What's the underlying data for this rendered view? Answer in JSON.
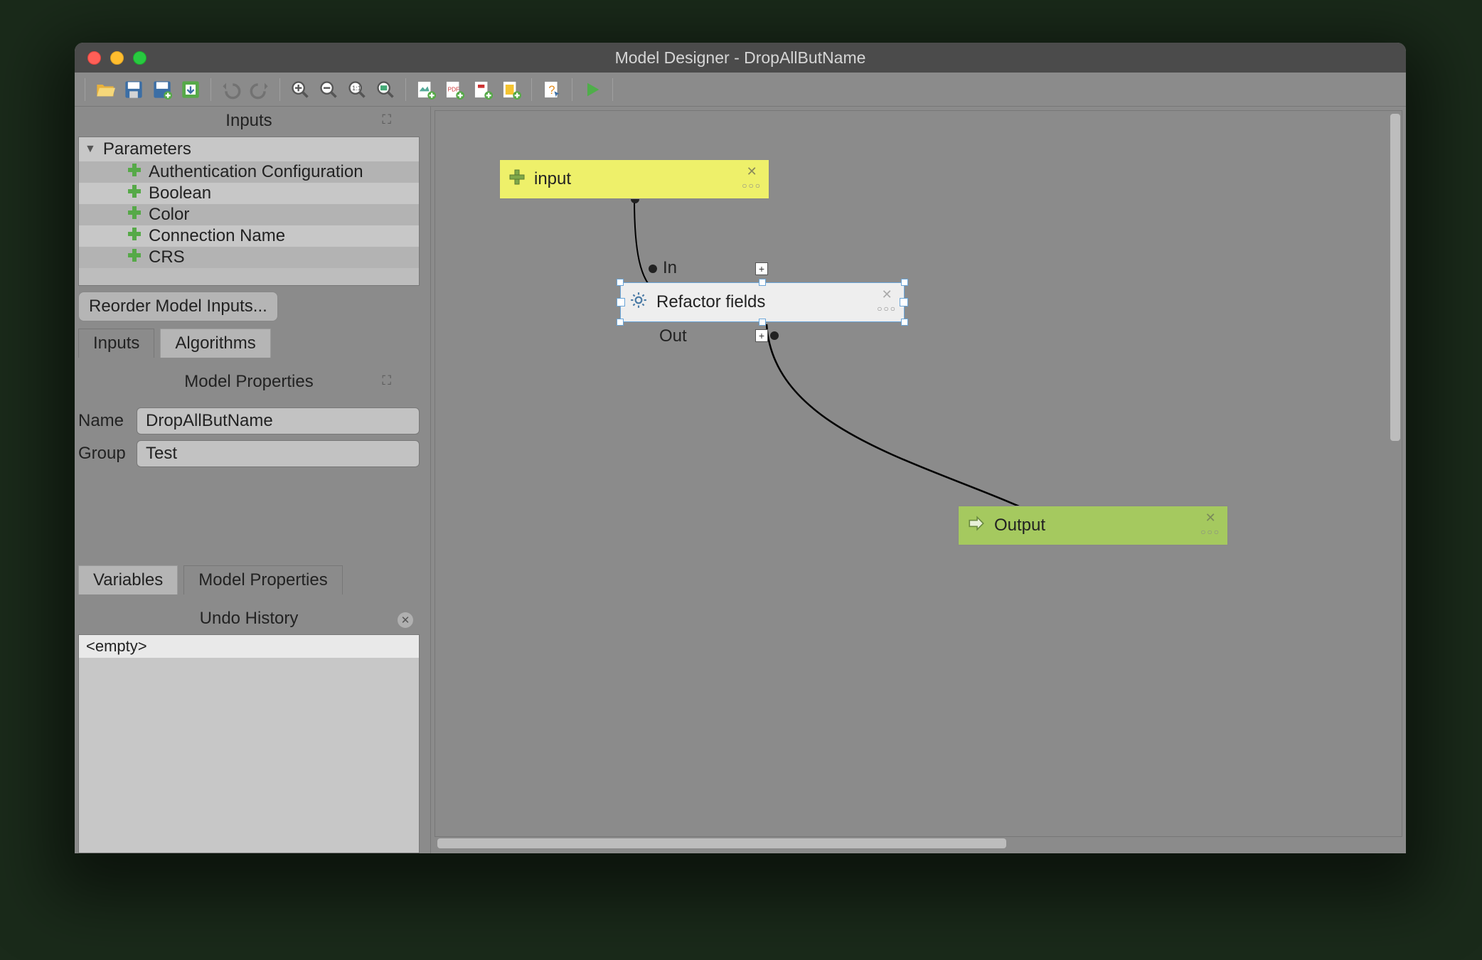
{
  "window": {
    "title": "Model Designer - DropAllButName"
  },
  "toolbar": {
    "buttons": [
      "open",
      "save",
      "save-as",
      "validate",
      "undo",
      "redo",
      "zoom-in",
      "zoom-out",
      "zoom-fit",
      "zoom-full",
      "export-image",
      "export-pdf",
      "export-svg",
      "export-py",
      "help",
      "run"
    ]
  },
  "inputs_panel": {
    "title": "Inputs",
    "root": "Parameters",
    "items": [
      "Authentication Configuration",
      "Boolean",
      "Color",
      "Connection Name",
      "CRS"
    ],
    "reorder_btn": "Reorder Model Inputs...",
    "tabs": {
      "inputs": "Inputs",
      "algorithms": "Algorithms"
    }
  },
  "model_properties": {
    "title": "Model Properties",
    "name_label": "Name",
    "name_value": "DropAllButName",
    "group_label": "Group",
    "group_value": "Test",
    "tabs": {
      "variables": "Variables",
      "model_properties": "Model Properties"
    }
  },
  "undo_history": {
    "title": "Undo History",
    "entries": [
      "<empty>"
    ]
  },
  "canvas": {
    "nodes": {
      "input": {
        "label": "input"
      },
      "algo": {
        "label": "Refactor fields",
        "in_label": "In",
        "out_label": "Out"
      },
      "output": {
        "label": "Output"
      }
    }
  }
}
